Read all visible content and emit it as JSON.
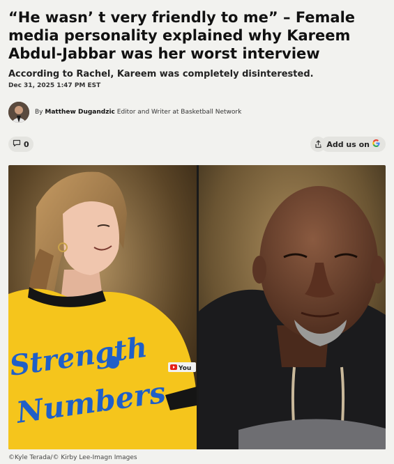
{
  "article": {
    "headline": "“He wasn’ t very friendly to me” – Female media personality explained why Kareem Abdul-Jabbar was her worst interview",
    "dek": "According to Rachel, Kareem was completely disinterested.",
    "date": "Dec 31, 2025 1:47 PM EST"
  },
  "byline": {
    "prefix": "By",
    "author": "Matthew Dugandzic",
    "role": "Editor and Writer at Basketball Network"
  },
  "actions": {
    "comment_count": "0",
    "add_us_label": "Add us on",
    "icons": [
      "comment-icon",
      "share-icon",
      "google-icon"
    ]
  },
  "image": {
    "credit": "©Kyle Terada/© Kirby Lee-Imagn Images",
    "shirt_text_line1": "Strength",
    "shirt_text_line2": "Numbers",
    "badge_text": "You"
  },
  "colors": {
    "background": "#f2f2ef",
    "shirt_yellow": "#f5c51c",
    "shirt_blue": "#1f5fc8",
    "google_blue": "#4285f4",
    "google_red": "#ea4335",
    "google_yellow": "#fbbc05",
    "google_green": "#34a853"
  }
}
